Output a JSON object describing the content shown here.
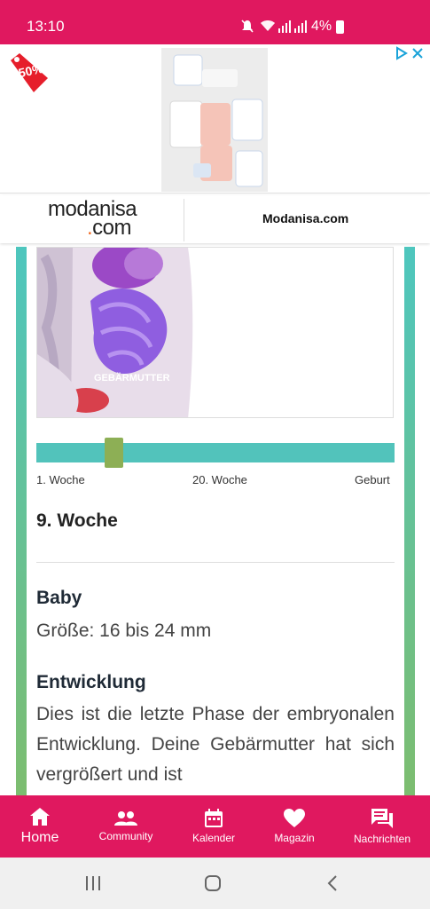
{
  "status": {
    "time": "13:10",
    "battery": "4%"
  },
  "ad": {
    "badge_text": "-50%",
    "brand_logo_line1": "modanisa",
    "brand_logo_dot": ".",
    "brand_logo_line2": "com",
    "brand_link": "Modanisa.com",
    "image_label": "GEBÄRMUTTER"
  },
  "slider": {
    "label_start": "1. Woche",
    "label_mid": "20. Woche",
    "label_end": "Geburt",
    "progress": 0.2
  },
  "content": {
    "week_title": "9. Woche",
    "baby_title": "Baby",
    "baby_size": "Größe: 16 bis 24 mm",
    "dev_title": "Entwicklung",
    "dev_text": "Dies ist die letzte Phase der embryonalen Entwicklung. Deine Gebärmutter hat sich vergrößert und ist"
  },
  "bottom_nav": {
    "items": [
      {
        "label": "Home",
        "icon": "home-icon"
      },
      {
        "label": "Community",
        "icon": "community-icon"
      },
      {
        "label": "Kalender",
        "icon": "calendar-icon"
      },
      {
        "label": "Magazin",
        "icon": "heart-icon"
      },
      {
        "label": "Nachrichten",
        "icon": "chat-icon"
      }
    ]
  },
  "colors": {
    "primary": "#e0185f",
    "teal": "#52c3bb",
    "green": "#8daf55"
  }
}
